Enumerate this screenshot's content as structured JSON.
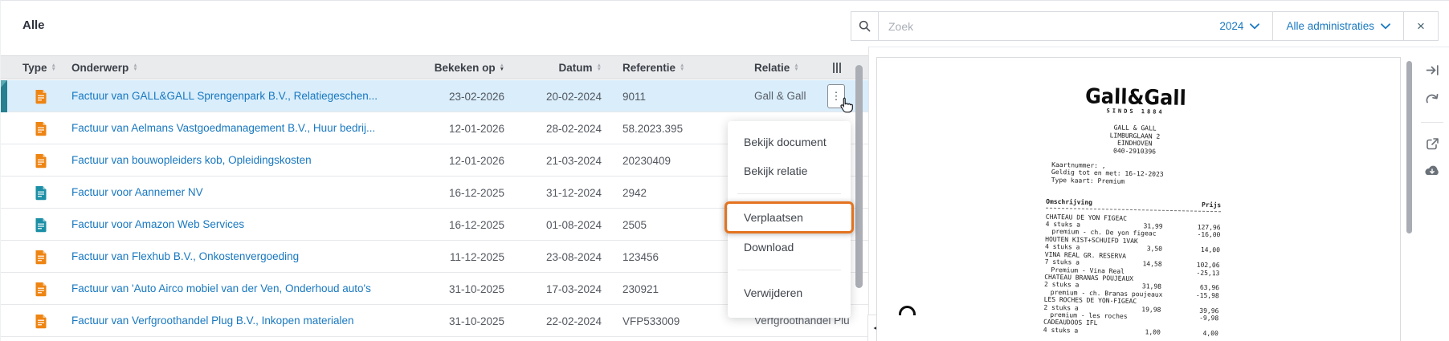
{
  "left_panel": {
    "title": "Alle",
    "columns": {
      "type": "Type",
      "onderwerp": "Onderwerp",
      "bekeken_op": "Bekeken op",
      "datum": "Datum",
      "referentie": "Referentie",
      "relatie": "Relatie"
    },
    "rows": [
      {
        "doc_type": "purchase",
        "subject": "Factuur van GALL&GALL Sprengenpark B.V., Relatiegeschen...",
        "bekeken_op": "23-02-2026",
        "datum": "20-02-2024",
        "referentie": "9011",
        "relatie": "Gall & Gall",
        "selected": true
      },
      {
        "doc_type": "purchase",
        "subject": "Factuur van Aelmans Vastgoedmanagement B.V., Huur bedrij...",
        "bekeken_op": "12-01-2026",
        "datum": "28-02-2024",
        "referentie": "58.2023.395",
        "relatie": "",
        "selected": false
      },
      {
        "doc_type": "purchase",
        "subject": "Factuur van bouwopleiders kob, Opleidingskosten",
        "bekeken_op": "12-01-2026",
        "datum": "21-03-2024",
        "referentie": "20230409",
        "relatie": "",
        "selected": false
      },
      {
        "doc_type": "sales",
        "subject": "Factuur voor Aannemer NV",
        "bekeken_op": "16-12-2025",
        "datum": "31-12-2024",
        "referentie": "2942",
        "relatie": "",
        "selected": false
      },
      {
        "doc_type": "sales",
        "subject": "Factuur voor Amazon Web Services",
        "bekeken_op": "16-12-2025",
        "datum": "01-08-2024",
        "referentie": "2505",
        "relatie": "",
        "selected": false
      },
      {
        "doc_type": "purchase",
        "subject": "Factuur van Flexhub B.V., Onkostenvergoeding",
        "bekeken_op": "11-12-2025",
        "datum": "23-08-2024",
        "referentie": "123456",
        "relatie": "",
        "selected": false
      },
      {
        "doc_type": "purchase",
        "subject": "Factuur van 'Auto Airco mobiel van der Ven, Onderhoud auto's",
        "bekeken_op": "31-10-2025",
        "datum": "17-03-2024",
        "referentie": "230921",
        "relatie": "",
        "selected": false
      },
      {
        "doc_type": "purchase",
        "subject": "Factuur van Verfgroothandel Plug B.V., Inkopen materialen",
        "bekeken_op": "31-10-2025",
        "datum": "22-02-2024",
        "referentie": "VFP533009",
        "relatie": "Verfgroothandel Plu",
        "selected": false
      }
    ]
  },
  "context_menu": {
    "items": [
      {
        "label": "Bekijk document"
      },
      {
        "label": "Bekijk relatie"
      },
      {
        "divider": true
      },
      {
        "label": "Verplaatsen",
        "highlighted": true
      },
      {
        "label": "Download"
      },
      {
        "divider": true
      },
      {
        "label": "Verwijderen"
      }
    ]
  },
  "search_bar": {
    "placeholder": "Zoek",
    "year": "2024",
    "administration": "Alle administraties",
    "close": "×"
  },
  "splitter_glyph": "◄►",
  "preview": {
    "receipt": {
      "logo": "Gall&Gall",
      "tagline": "SINDS 1884",
      "address": [
        "GALL & GALL",
        "LIMBURGLAAN 2",
        "EINDHOVEN",
        "040-2910396"
      ],
      "card_info": [
        "Kaartnummer: ,",
        "Geldig tot en met: 16-12-2023",
        "Type kaart: Premium"
      ],
      "col_item": "Omschrijving",
      "col_price": "Prijs",
      "lines": [
        {
          "name": "CHATEAU DE YON FIGEAC",
          "qty": "4 stuks a",
          "unit": "31,99",
          "total": "127,96",
          "disc": "premium - ch. De yon figeac",
          "disc_amt": "-16,00"
        },
        {
          "name": "HOUTEN KIST+SCHUIFD 1VAK",
          "qty": "4 stuks a",
          "unit": "3,50",
          "total": "14,00"
        },
        {
          "name": "VINA REAL GR. RESERVA",
          "qty": "7 stuks a",
          "unit": "14,58",
          "total": "102,06",
          "disc": "Premium - Vina Real",
          "disc_amt": "-25,13"
        },
        {
          "name": "CHATEAU BRANAS POUJEAUX",
          "qty": "2 stuks a",
          "unit": "31,98",
          "total": "63,96",
          "disc": "premium - ch. Branas poujeaux",
          "disc_amt": "-15,98"
        },
        {
          "name": "LES ROCHES DE YON-FIGEAC",
          "qty": "2 stuks a",
          "unit": "19,98",
          "total": "39,96",
          "disc": "premium - les roches",
          "disc_amt": "-9,98"
        },
        {
          "name": "CADEAUDOOS IFL",
          "qty": "4 stuks a",
          "unit": "1,00",
          "total": "4,00"
        }
      ]
    }
  },
  "colors": {
    "link_blue": "#1878c0",
    "selected_row_bg": "#d9edfb",
    "selection_bar_teal": "#26808f",
    "purchase_icon_orange": "#ee8412",
    "sales_icon_teal": "#1b8fa6",
    "highlight_orange": "#e4731f",
    "header_bg": "#eaebec"
  }
}
